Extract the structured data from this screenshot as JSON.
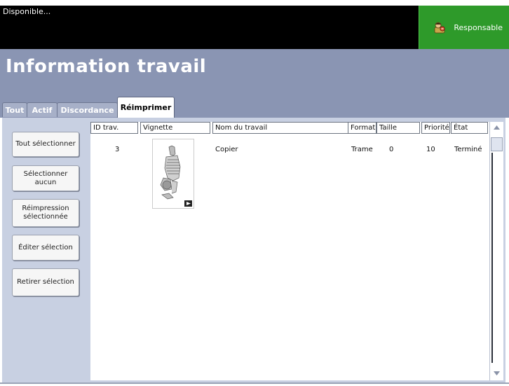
{
  "status": {
    "text": "Disponible..."
  },
  "user": {
    "label": "Responsable",
    "icon": "admin-user-icon"
  },
  "page": {
    "title": "Information travail"
  },
  "tabs": [
    {
      "label": "Tout"
    },
    {
      "label": "Actif"
    },
    {
      "label": "Discordance"
    },
    {
      "label": "Réimprimer",
      "active": true
    }
  ],
  "buttons": {
    "select_all": "Tout sélectionner",
    "select_none": "Sélectionner aucun",
    "reprint_selected": "Réimpression sélectionnée",
    "edit_selection": "Éditer sélection",
    "remove_selection": "Retirer sélection"
  },
  "table": {
    "columns": [
      "ID trav.",
      "Vignette",
      "Nom du travail",
      "Format",
      "Taille",
      "Priorité",
      "État"
    ],
    "rows": [
      {
        "id": "3",
        "thumbnail": "job-thumbnail",
        "name": "Copier",
        "format": "Trame",
        "size": "0",
        "priority": "10",
        "state": "Terminé"
      }
    ]
  },
  "colors": {
    "topbar": "#000000",
    "responsable_bg": "#2e9a2a",
    "header_bg": "#8a95b3",
    "content_bg": "#c8d0e2"
  }
}
